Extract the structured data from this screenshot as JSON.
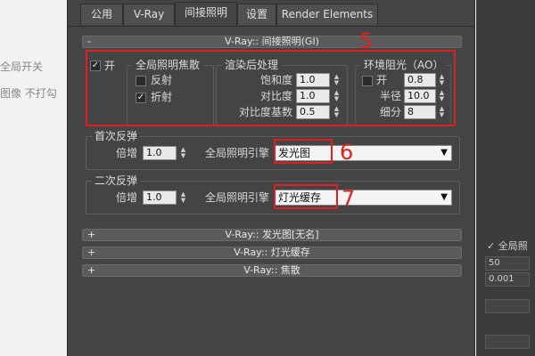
{
  "background": {
    "left_text_1": "全局开关",
    "left_text_2": "图像  不打勾",
    "right_checkbox_label": "全局照",
    "right_value_1": "50",
    "right_value_2": "0.001"
  },
  "tabs": [
    "公用",
    "V-Ray",
    "间接照明",
    "设置",
    "Render Elements"
  ],
  "gi_rollout": {
    "title": "V-Ray:: 间接照明(GI)",
    "sign": "-",
    "on_label": "开",
    "on_checked": true,
    "caustics": {
      "label": "全局照明焦散",
      "reflect_label": "反射",
      "reflect_checked": false,
      "refract_label": "折射",
      "refract_checked": true
    },
    "post": {
      "label": "渲染后处理",
      "saturation_label": "饱和度",
      "saturation_value": "1.0",
      "contrast_label": "对比度",
      "contrast_value": "1.0",
      "contrast_base_label": "对比度基数",
      "contrast_base_value": "0.5"
    },
    "ao": {
      "label": "环境阻光（AO）",
      "on_label": "开",
      "on_checked": false,
      "on_value": "0.8",
      "radius_label": "半径",
      "radius_value": "10.0",
      "subdivs_label": "细分",
      "subdivs_value": "8"
    }
  },
  "primary": {
    "label": "首次反弹",
    "mult_label": "倍增",
    "mult_value": "1.0",
    "engine_label": "全局照明引擎",
    "engine_value": "发光图"
  },
  "secondary": {
    "label": "二次反弹",
    "mult_label": "倍增",
    "mult_value": "1.0",
    "engine_label": "全局照明引擎",
    "engine_value": "灯光缓存"
  },
  "collapsed_rollouts": [
    {
      "sign": "+",
      "title": "V-Ray:: 发光图[无名]"
    },
    {
      "sign": "+",
      "title": "V-Ray:: 灯光缓存"
    },
    {
      "sign": "+",
      "title": "V-Ray:: 焦散"
    }
  ],
  "annotations": [
    "5",
    "6",
    "7"
  ],
  "colors": {
    "panel_bg": "#444444",
    "annotation_red": "#e02020"
  }
}
